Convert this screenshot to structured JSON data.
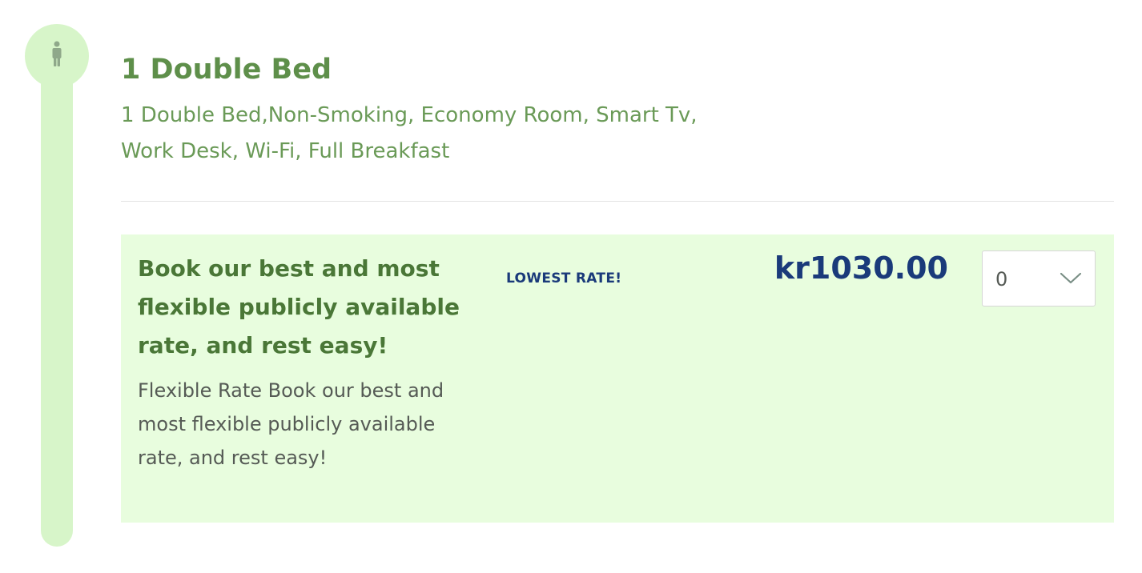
{
  "room": {
    "title": "1 Double Bed",
    "description_line1": "1 Double Bed,Non-Smoking, Economy Room, Smart Tv,",
    "description_line2": "Work Desk, Wi-Fi, Full Breakfast"
  },
  "rate": {
    "headline": "Book our best and most flexible publicly available rate, and rest easy!",
    "description": "Flexible Rate Book our best and most flexible publicly available rate, and rest easy!",
    "badge": "LOWEST RATE!",
    "price": "kr1030.00",
    "quantity": {
      "selected": "0"
    }
  },
  "icons": {
    "rail_icon": "person-icon",
    "select_icon": "chevron-down-icon"
  },
  "colors": {
    "accent_green": "#5e8f4a",
    "rail_green": "#d7f5c9",
    "card_bg": "#e8fdde",
    "price_navy": "#1a3a7a"
  }
}
